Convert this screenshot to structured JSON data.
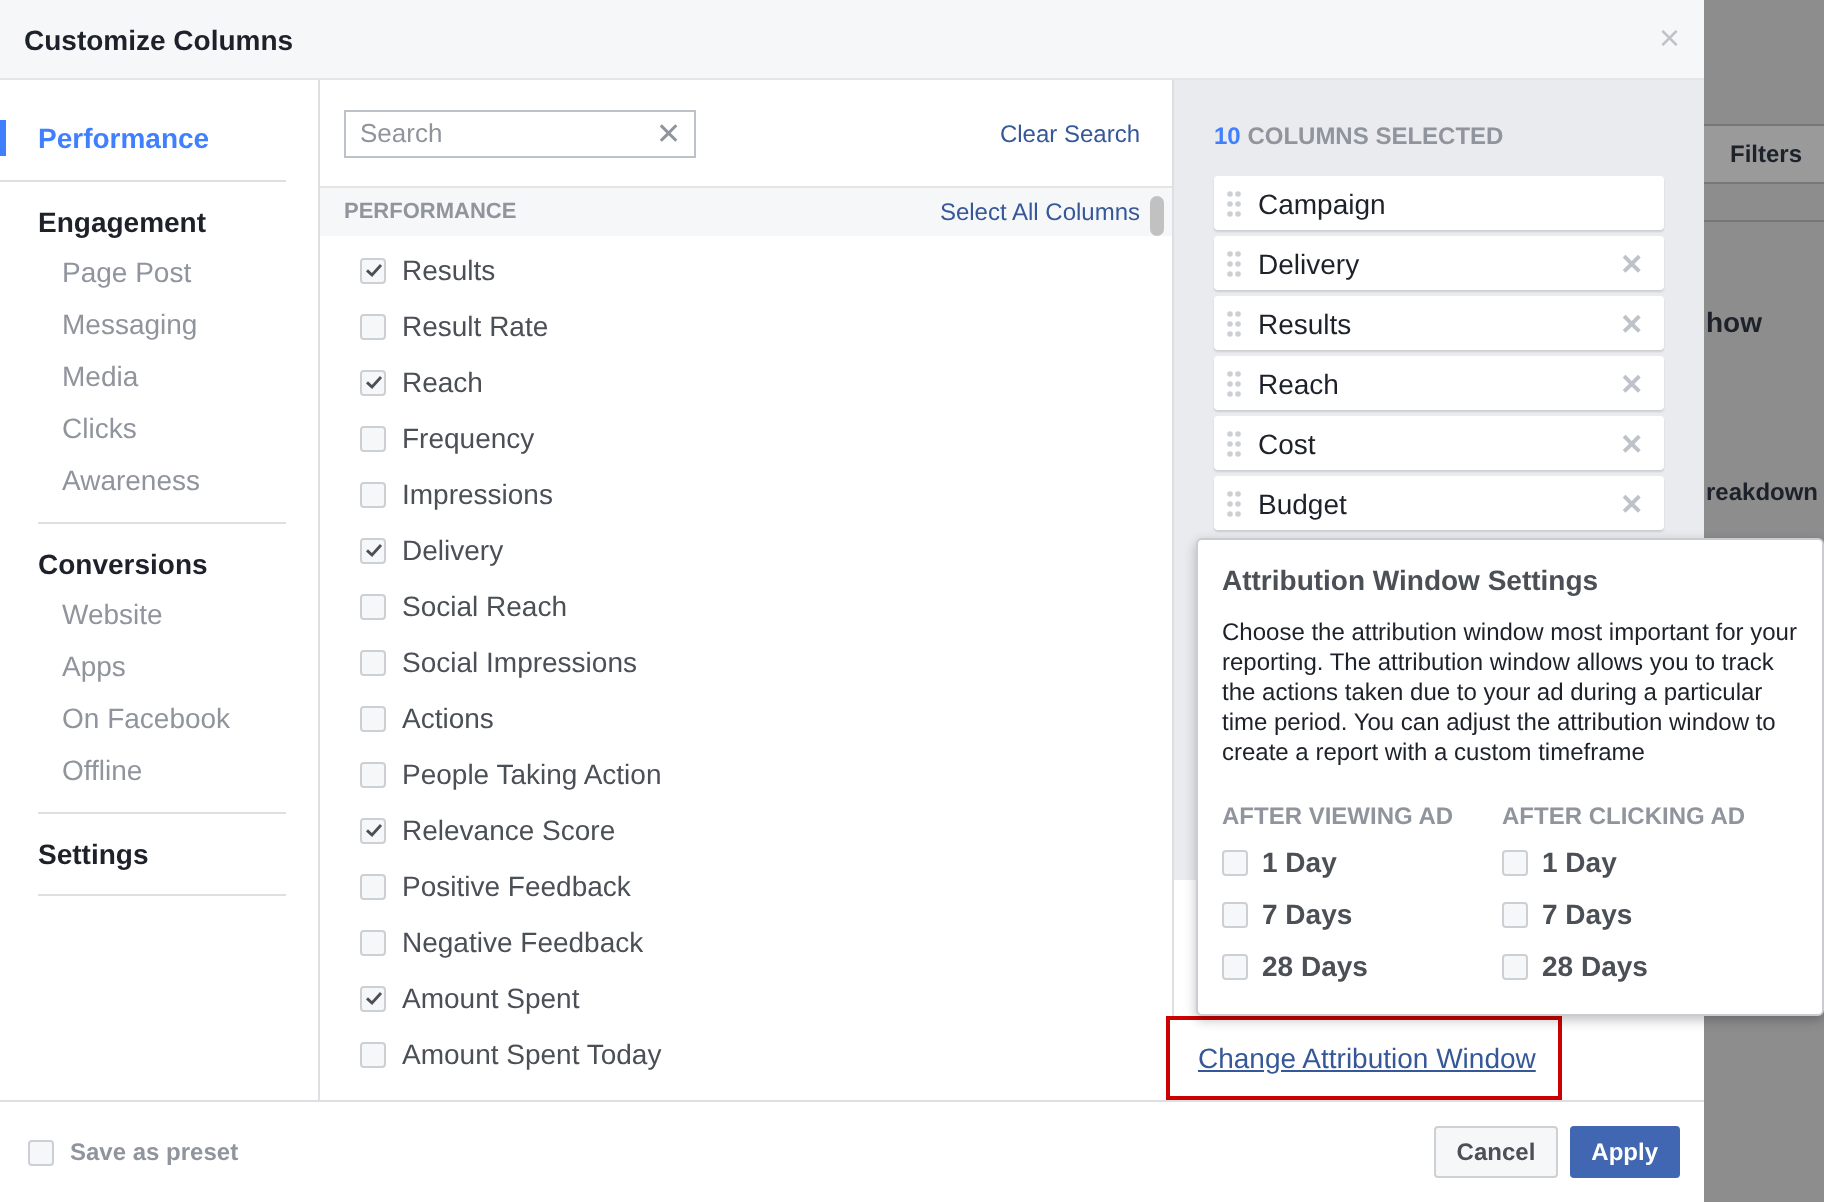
{
  "window": {
    "title": "Customize Columns",
    "close": "×"
  },
  "background": {
    "filters": "Filters",
    "texts": [
      "how",
      "reakdown"
    ]
  },
  "nav": [
    {
      "label": "Performance",
      "selected": true
    },
    {
      "label": "Engagement",
      "selected": false,
      "children": [
        {
          "label": "Page Post",
          "selected": false
        },
        {
          "label": "Messaging",
          "selected": false
        },
        {
          "label": "Media",
          "selected": false
        },
        {
          "label": "Clicks",
          "selected": false
        },
        {
          "label": "Awareness",
          "selected": false
        }
      ]
    },
    {
      "label": "Conversions",
      "selected": false,
      "children": [
        {
          "label": "Website",
          "selected": false
        },
        {
          "label": "Apps",
          "selected": false
        },
        {
          "label": "On Facebook",
          "selected": false
        },
        {
          "label": "Offline",
          "selected": false
        }
      ]
    },
    {
      "label": "Settings",
      "selected": false
    }
  ],
  "search": {
    "placeholder": "Search",
    "clear_icon": "✕",
    "clear": "Clear Search"
  },
  "section": {
    "title": "PERFORMANCE",
    "select_all": "Select All Columns"
  },
  "metrics": [
    {
      "label": "Results",
      "checked": true
    },
    {
      "label": "Result Rate",
      "checked": false
    },
    {
      "label": "Reach",
      "checked": true
    },
    {
      "label": "Frequency",
      "checked": false
    },
    {
      "label": "Impressions",
      "checked": false
    },
    {
      "label": "Delivery",
      "checked": true
    },
    {
      "label": "Social Reach",
      "checked": false
    },
    {
      "label": "Social Impressions",
      "checked": false
    },
    {
      "label": "Actions",
      "checked": false
    },
    {
      "label": "People Taking Action",
      "checked": false
    },
    {
      "label": "Relevance Score",
      "checked": true
    },
    {
      "label": "Positive Feedback",
      "checked": false
    },
    {
      "label": "Negative Feedback",
      "checked": false
    },
    {
      "label": "Amount Spent",
      "checked": true
    },
    {
      "label": "Amount Spent Today",
      "checked": false
    }
  ],
  "selected_columns": {
    "count": "10",
    "label": "COLUMNS SELECTED",
    "columns": [
      {
        "name": "Campaign"
      },
      {
        "name": "Delivery",
        "remove": "✕"
      },
      {
        "name": "Results",
        "remove": "✕"
      },
      {
        "name": "Reach",
        "remove": "✕"
      },
      {
        "name": "Cost",
        "remove": "✕"
      },
      {
        "name": "Budget",
        "remove": "✕"
      }
    ]
  },
  "popover": {
    "title": "Attribution Window Settings",
    "text": "Choose the attribution window most important for your reporting. The attribution window allows you to track the actions taken due to your ad during a particular time period. You can adjust the attribution window to create a report with a custom timeframe",
    "groups": [
      {
        "title": "AFTER VIEWING AD",
        "options": [
          {
            "label": "1 Day",
            "checked": false
          },
          {
            "label": "7 Days",
            "checked": false
          },
          {
            "label": "28 Days",
            "checked": false
          }
        ]
      },
      {
        "title": "AFTER CLICKING AD",
        "options": [
          {
            "label": "1 Day",
            "checked": false
          },
          {
            "label": "7 Days",
            "checked": false
          },
          {
            "label": "28 Days",
            "checked": false
          }
        ]
      }
    ]
  },
  "attribution_link": {
    "label": "Change Attribution Window",
    "highlighted": true
  },
  "footer": {
    "save_preset": {
      "label": "Save as preset",
      "checked": false
    },
    "buttons": [
      {
        "label": "Cancel",
        "kind": "secondary"
      },
      {
        "label": "Apply",
        "kind": "primary"
      }
    ]
  }
}
